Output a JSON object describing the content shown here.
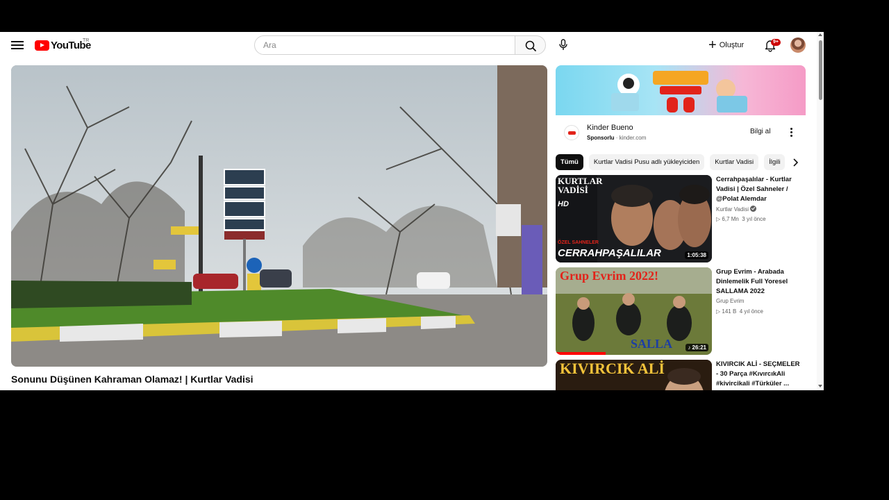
{
  "header": {
    "logo_text": "YouTube",
    "country_code": "TR",
    "search_placeholder": "Ara",
    "create_label": "Oluştur",
    "notification_count": "9+"
  },
  "video": {
    "title": "Sonunu Düşünen Kahraman Olamaz! | Kurtlar Vadisi"
  },
  "ad": {
    "advertiser": "Kinder Bueno",
    "sponsored_label": "Sponsorlu",
    "separator": "·",
    "domain": "kinder.com",
    "cta_label": "Bilgi al"
  },
  "chips": [
    {
      "label": "Tümü",
      "active": true
    },
    {
      "label": "Kurtlar Vadisi Pusu adlı yükleyiciden",
      "active": false
    },
    {
      "label": "Kurtlar Vadisi",
      "active": false
    },
    {
      "label": "İlgili",
      "active": false
    }
  ],
  "recommendations": [
    {
      "title": "Cerrahpaşalılar - Kurtlar Vadisi | Özel Sahneler / @Polat Alemdar",
      "channel": "Kurtlar Vadisi",
      "verified": true,
      "views": "▷ 6,7 Mn",
      "age": "3 yıl önce",
      "duration": "1:05:38",
      "thumb_text_top": "KURTLAR VADİSİ",
      "thumb_badge": "HD",
      "thumb_text_bottom_small": "ÖZEL SAHNELER",
      "thumb_text_bottom": "CERRAHPAŞALILAR"
    },
    {
      "title": "Grup Evrim - Arabada Dinlemelik Full Yoresel SALLAMA 2022",
      "channel": "Grup Evrim",
      "verified": false,
      "views": "▷ 141 B",
      "age": "4 yıl önce",
      "duration": "♪ 26:21",
      "thumb_text_top": "Grup Evrim 2022!",
      "thumb_text_bottom": "SALLA"
    },
    {
      "title": "KIVIRCIK ALİ - SEÇMELER - 30 Parça #KıvırcıkAli #kivircikali #Türküler ...",
      "thumb_text_top": "KIVIRCIK ALİ"
    }
  ],
  "colors": {
    "brand_red": "#ff0000",
    "text_primary": "#0f0f0f",
    "text_secondary": "#606060",
    "chip_bg": "#f2f2f2",
    "chip_active_bg": "#0f0f0f",
    "badge_red": "#cc0000"
  },
  "icons": [
    "menu-icon",
    "youtube-logo-icon",
    "search-icon",
    "microphone-icon",
    "plus-icon",
    "bell-icon",
    "kebab-menu-icon",
    "chevron-right-icon",
    "verified-icon"
  ]
}
